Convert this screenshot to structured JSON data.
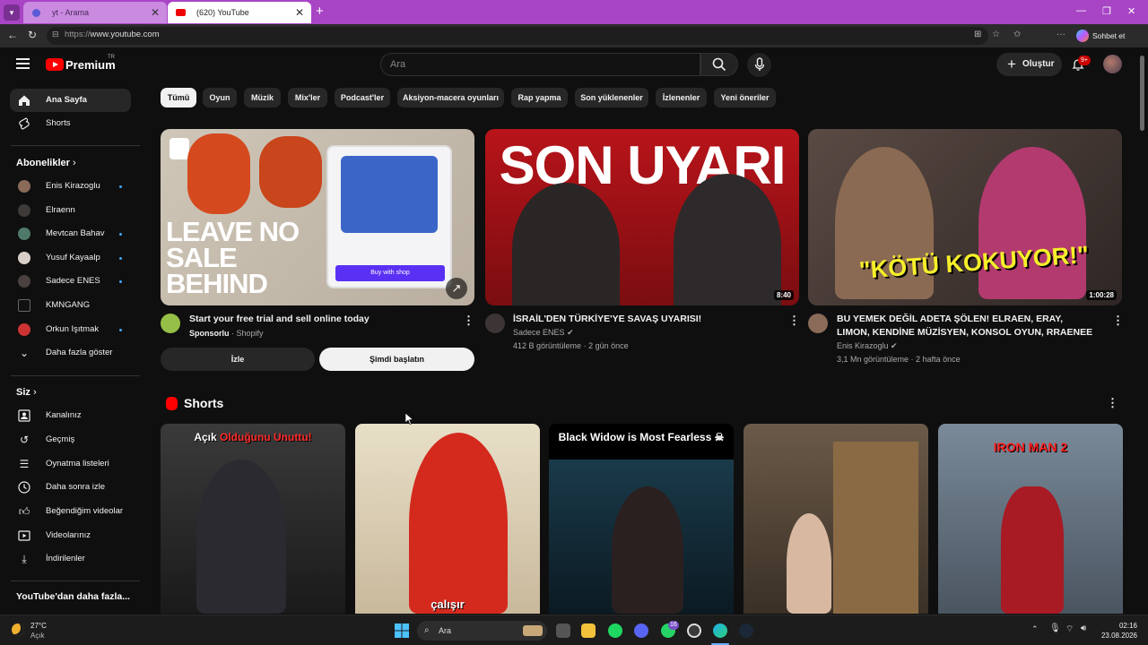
{
  "browser": {
    "tabs": [
      {
        "title": "yt - Arama"
      },
      {
        "title": "(620) YouTube"
      }
    ],
    "address": {
      "scheme": "https://",
      "host": "www.youtube.com"
    },
    "copilot_label": "Sohbet et"
  },
  "header": {
    "logo_text": "Premium",
    "region": "TR",
    "search_placeholder": "Ara",
    "create_label": "Oluştur",
    "notification_count": "9+"
  },
  "sidebar": {
    "main": [
      {
        "label": "Ana Sayfa",
        "icon": "home-icon",
        "active": true
      },
      {
        "label": "Shorts",
        "icon": "shorts-icon",
        "active": false
      }
    ],
    "subscriptions_heading": "Abonelikler",
    "subscriptions": [
      {
        "label": "Enis Kirazoglu",
        "new": true
      },
      {
        "label": "Elraenn",
        "new": false
      },
      {
        "label": "Mevtcan Bahav",
        "new": true
      },
      {
        "label": "Yusuf Kayaalp",
        "new": true
      },
      {
        "label": "Sadece ENES",
        "new": true
      },
      {
        "label": "KMNGANG",
        "new": false
      },
      {
        "label": "Orkun Işıtmak",
        "new": true
      }
    ],
    "show_more": "Daha fazla göster",
    "you_heading": "Siz",
    "you": [
      {
        "label": "Kanalınız",
        "icon": "channel-icon"
      },
      {
        "label": "Geçmiş",
        "icon": "history-icon"
      },
      {
        "label": "Oynatma listeleri",
        "icon": "playlists-icon"
      },
      {
        "label": "Daha sonra izle",
        "icon": "watch-later-icon"
      },
      {
        "label": "Beğendiğim videolar",
        "icon": "like-icon"
      },
      {
        "label": "Videolarınız",
        "icon": "your-videos-icon"
      },
      {
        "label": "İndirilenler",
        "icon": "download-icon"
      }
    ],
    "more_from": "YouTube'dan daha fazla..."
  },
  "chips": [
    "Tümü",
    "Oyun",
    "Müzik",
    "Mix'ler",
    "Podcast'ler",
    "Aksiyon-macera oyunları",
    "Rap yapma",
    "Son yüklenenler",
    "İzlenenler",
    "Yeni öneriler"
  ],
  "ad": {
    "thumb_text": "LEAVE NO SALE BEHIND",
    "cta_small": "Buy with shop",
    "title": "Start your free trial and sell online today",
    "sponsored": "Sponsorlu",
    "advertiser": "Shopify",
    "watch_label": "İzle",
    "start_label": "Şimdi başlatın"
  },
  "videos": [
    {
      "thumb_text": "SON UYARI",
      "duration": "8:40",
      "title": "İSRAİL'DEN TÜRKİYE'YE SAVAŞ UYARISI!",
      "channel": "Sadece ENES",
      "views": "412 B görüntüleme",
      "age": "2 gün önce"
    },
    {
      "thumb_text": "\"KÖTÜ KOKUYOR!\"",
      "duration": "1:00:28",
      "title": "BU YEMEK DEĞİL ADETA ŞÖLEN! ELRAEN, ERAY, LIMON, KENDİNE MÜZİSYEN, KONSOL OYUN, RRAENEE",
      "channel": "Enis Kirazoglu",
      "views": "3,1 Mn görüntüleme",
      "age": "2 hafta önce"
    }
  ],
  "shorts": {
    "heading": "Shorts",
    "items": [
      {
        "caption_a": "Açık ",
        "caption_b": "Olduğunu Unuttu!",
        "bottom": ""
      },
      {
        "caption_a": "",
        "caption_b": "",
        "bottom": "çalışır"
      },
      {
        "caption_a": "Black Widow is Most Fearless ☠",
        "caption_b": "",
        "bottom": ""
      },
      {
        "caption_a": "",
        "caption_b": "",
        "bottom": ""
      },
      {
        "caption_a": "IRON MAN 2",
        "caption_b": "",
        "bottom": ""
      }
    ]
  },
  "taskbar": {
    "temperature": "27°C",
    "condition": "Açık",
    "search_label": "Ara",
    "time": "02:16",
    "date": "23.08.2026",
    "whatsapp_badge": "16"
  },
  "colors": {
    "background": "#0f0f0f",
    "accent_red": "#ff0000",
    "tabbar": "#a845c5",
    "link_blue": "#3ea6ff"
  }
}
